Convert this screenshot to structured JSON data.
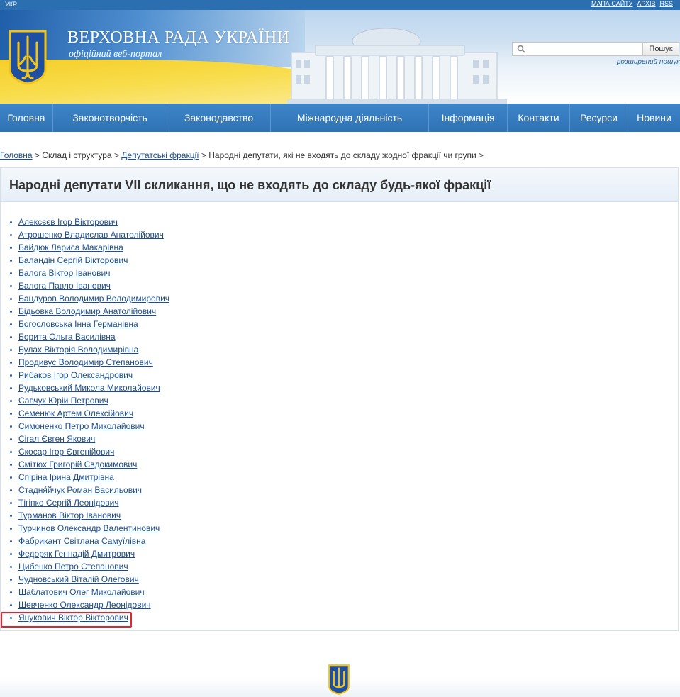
{
  "topbar": {
    "lang": "УКР",
    "links": [
      "МАПА САЙТУ",
      "АРХІВ",
      "RSS"
    ]
  },
  "header": {
    "title": "ВЕРХОВНА РАДА УКРАЇНИ",
    "subtitle": "офіційний веб-портал"
  },
  "search": {
    "placeholder": "",
    "button": "Пошук",
    "advanced": "розширений пошук"
  },
  "nav": [
    "Головна",
    "Законотворчість",
    "Законодавство",
    "Міжнародна діяльність",
    "Інформація",
    "Контакти",
    "Ресурси",
    "Новини"
  ],
  "breadcrumb": {
    "home": "Головна",
    "sep1": " > ",
    "structure": "Склад і структура",
    "sep2": " > ",
    "factions": "Депутатські фракції",
    "sep3": " > ",
    "current": "Народні депутати, які не входять до складу жодної фракції чи групи",
    "sep4": " >"
  },
  "page_title": "Народні депутати VII скликання, що не входять до складу будь-якої фракції",
  "deputies": [
    "Алексєєв Ігор Вікторович",
    "Атрошенко Владислав Анатолійович",
    "Байдюк Лариса Макарівна",
    "Баландін Сергій Вікторович",
    "Балога Віктор Іванович",
    "Балога Павло Іванович",
    "Бандуров Володимир Володимирович",
    "Бідьовка Володимир Анатолійович",
    "Богословська Інна Германівна",
    "Борита Ольга Василівна",
    "Булах Вікторія Володимирівна",
    "Продивус Володимир Степанович",
    "Рибаков Ігор Олександрович",
    "Рудьковський Микола Миколайович",
    "Савчук Юрій Петрович",
    "Семенюк Артем Олексійович",
    "Симоненко Петро Миколайович",
    "Сігал Євген Якович",
    "Скосар Ігор Євгенійович",
    "Смітюх Григорій Євдокимович",
    "Спіріна Ірина Дмитрівна",
    "Стадня́йчук Роман Васильович",
    "Тігіпко Сергій Леонідович",
    "Турманов Віктор Іванович",
    "Турчинов Олександр Валентинович",
    "Фабрикант Світлана Самуїлівна",
    "Федоряк Геннадій Дмитрович",
    "Цибенко Петро Степанович",
    "Чудновський Віталій Олегович",
    "Шаблатович Олег Миколайович",
    "Шевченко Олександр Леонідович",
    "Янукович Віктор Вікторович"
  ],
  "highlighted_deputy": "Скосар Ігор Євгенійович",
  "colors": {
    "nav_bg": "#3d86c9",
    "link": "#1a4f8f",
    "highlight": "#e3232d",
    "flag_blue": "#1f5ea8",
    "flag_yellow": "#f5cf2a"
  }
}
